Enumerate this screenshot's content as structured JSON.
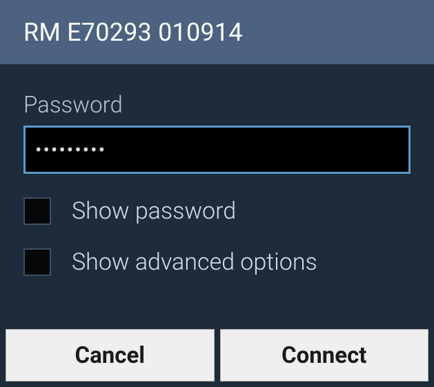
{
  "dialog": {
    "title": "RM E70293 010914"
  },
  "password": {
    "label": "Password",
    "value": "•••••••••"
  },
  "options": {
    "show_password_label": "Show password",
    "show_password_checked": false,
    "show_advanced_label": "Show advanced options",
    "show_advanced_checked": false
  },
  "buttons": {
    "cancel": "Cancel",
    "connect": "Connect"
  },
  "colors": {
    "title_bg": "#4c6280",
    "body_bg": "#1d2b3a",
    "accent": "#5b9bc8"
  }
}
